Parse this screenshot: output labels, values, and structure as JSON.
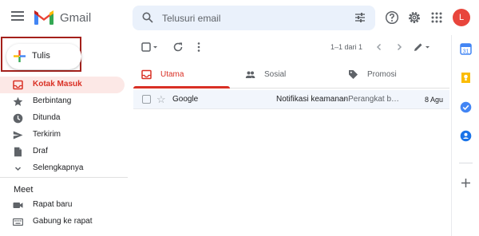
{
  "app": {
    "name": "Gmail",
    "avatar_letter": "L"
  },
  "icons": {
    "menu": "hamburger-icon",
    "logo": "gmail-m-logo",
    "search": "search-icon",
    "filter": "tune-icon",
    "help": "help-icon",
    "settings": "gear-icon",
    "apps": "apps-grid-icon"
  },
  "search": {
    "placeholder": "Telusuri email"
  },
  "compose": {
    "label": "Tulis"
  },
  "nav": [
    {
      "label": "Kotak Masuk",
      "icon": "inbox-icon",
      "active": true
    },
    {
      "label": "Berbintang",
      "icon": "star-icon"
    },
    {
      "label": "Ditunda",
      "icon": "clock-icon"
    },
    {
      "label": "Terkirim",
      "icon": "send-icon"
    },
    {
      "label": "Draf",
      "icon": "draft-icon"
    },
    {
      "label": "Selengkapnya",
      "icon": "chevron-down-icon"
    }
  ],
  "meet": {
    "title": "Meet",
    "items": [
      {
        "label": "Rapat baru",
        "icon": "video-icon"
      },
      {
        "label": "Gabung ke rapat",
        "icon": "keyboard-icon"
      }
    ]
  },
  "toolbar": {
    "page_info": "1–1 dari 1"
  },
  "tabs": [
    {
      "label": "Utama",
      "icon": "inbox-icon",
      "active": true
    },
    {
      "label": "Sosial",
      "icon": "people-icon"
    },
    {
      "label": "Promosi",
      "icon": "tag-icon"
    }
  ],
  "emails": [
    {
      "sender": "Google",
      "subject": "Notifikasi keamanan",
      "snippet": " - Perangkat baru",
      "date": "8 Agu"
    }
  ],
  "colors": {
    "accent": "#d93025",
    "highlight_frame": "#a4201b",
    "search_bg": "#eaf1fb",
    "active_nav_bg": "#fce8e6"
  }
}
